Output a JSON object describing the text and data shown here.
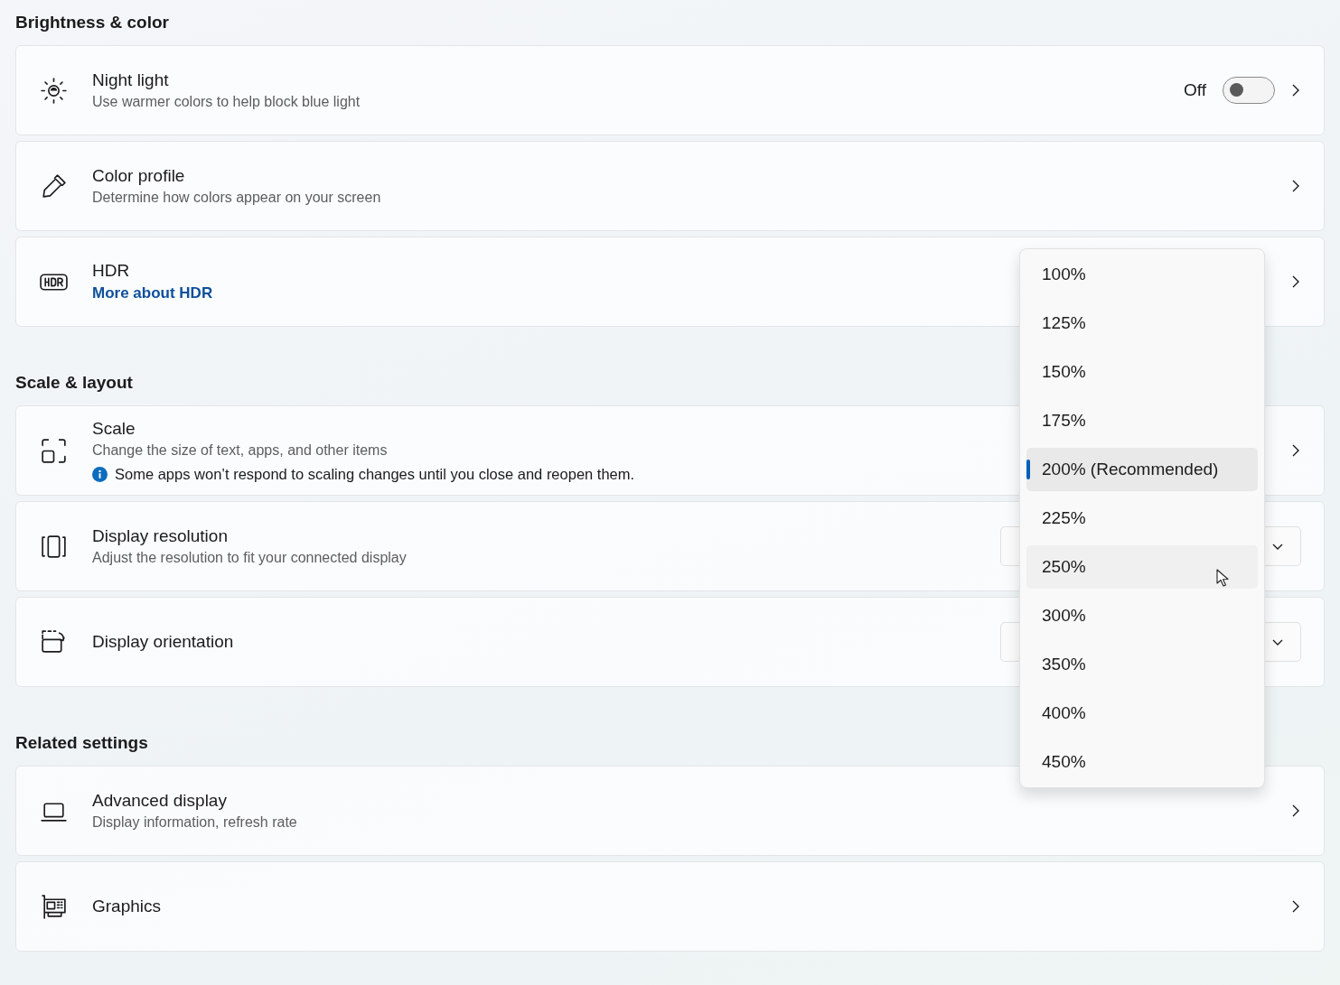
{
  "sections": [
    {
      "title": "Brightness & color",
      "cards": [
        {
          "kind": "toggle",
          "title": "Night light",
          "subtitle": "Use warmer colors to help block blue light",
          "toggle": {
            "label": "Off",
            "on": false
          }
        },
        {
          "kind": "chevron",
          "title": "Color profile",
          "subtitle": "Determine how colors appear on your screen"
        },
        {
          "kind": "chevron",
          "title": "HDR",
          "link": "More about HDR"
        }
      ]
    },
    {
      "title": "Scale & layout",
      "cards": [
        {
          "kind": "chevron",
          "title": "Scale",
          "subtitle": "Change the size of text, apps, and other items",
          "note": "Some apps won’t respond to scaling changes until you close and reopen them."
        },
        {
          "kind": "dropdown",
          "title": "Display resolution",
          "subtitle": "Adjust the resolution to fit your connected display"
        },
        {
          "kind": "dropdown",
          "title": "Display orientation"
        }
      ]
    },
    {
      "title": "Related settings",
      "cards": [
        {
          "kind": "chevron",
          "title": "Advanced display",
          "subtitle": "Display information, refresh rate"
        },
        {
          "kind": "chevron",
          "title": "Graphics"
        }
      ]
    }
  ],
  "scale_menu": {
    "items": [
      {
        "label": "100%",
        "selected": false,
        "hovered": false
      },
      {
        "label": "125%",
        "selected": false,
        "hovered": false
      },
      {
        "label": "150%",
        "selected": false,
        "hovered": false
      },
      {
        "label": "175%",
        "selected": false,
        "hovered": false
      },
      {
        "label": "200% (Recommended)",
        "selected": true,
        "hovered": false
      },
      {
        "label": "225%",
        "selected": false,
        "hovered": false
      },
      {
        "label": "250%",
        "selected": false,
        "hovered": true
      },
      {
        "label": "300%",
        "selected": false,
        "hovered": false
      },
      {
        "label": "350%",
        "selected": false,
        "hovered": false
      },
      {
        "label": "400%",
        "selected": false,
        "hovered": false
      },
      {
        "label": "450%",
        "selected": false,
        "hovered": false
      }
    ]
  }
}
